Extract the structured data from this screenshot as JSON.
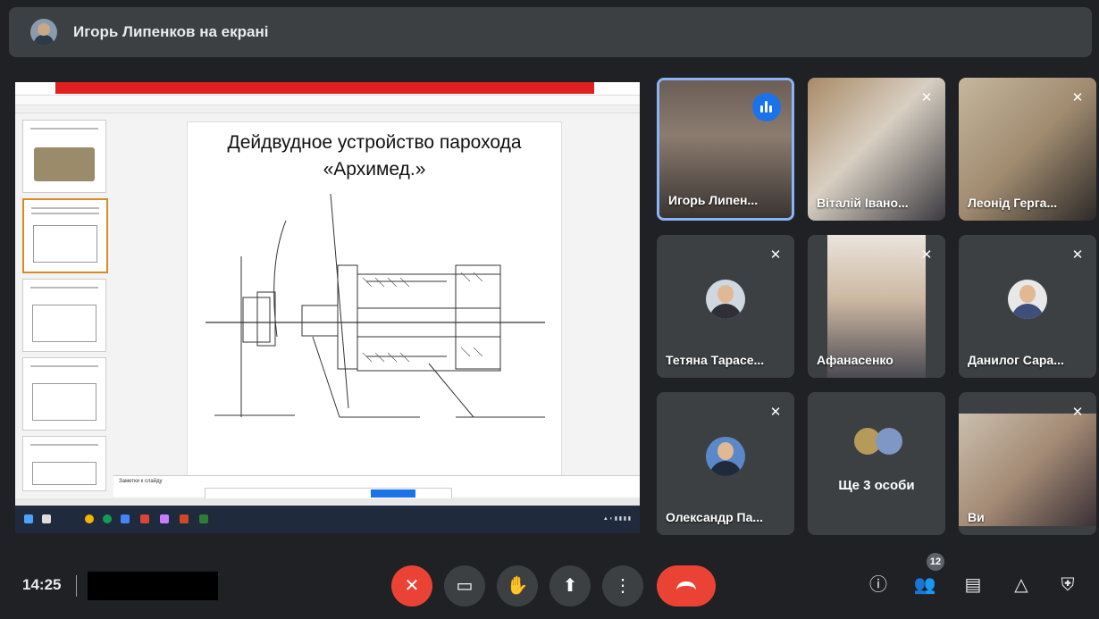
{
  "header": {
    "presenter_title": "Игорь Липенков на екрані"
  },
  "slide": {
    "title_line1": "Дейдвудное устройство парохода",
    "title_line2": "«Архимед.»",
    "notes_label": "Заметки к слайду"
  },
  "participants": [
    {
      "name": "Игорь Липен...",
      "state": "speaking"
    },
    {
      "name": "Віталій Івано...",
      "state": "muted"
    },
    {
      "name": "Леонід Герга...",
      "state": "muted"
    },
    {
      "name": "Тетяна Тарасе...",
      "state": "muted"
    },
    {
      "name": "Афанасенко",
      "state": "muted"
    },
    {
      "name": "Данилог Сара...",
      "state": "muted"
    },
    {
      "name": "Олександр Па...",
      "state": "muted"
    },
    {
      "name": "Ще 3 особи",
      "state": "group"
    },
    {
      "name": "Ви",
      "state": "muted"
    }
  ],
  "bottom_bar": {
    "clock": "14:25",
    "participant_count": "12"
  },
  "icons": {
    "mic_off": "✕",
    "camera": "▭",
    "raise_hand": "✋",
    "present": "⬆",
    "more": "⋮",
    "info": "ⓘ",
    "people": "👥",
    "chat": "▤",
    "activities": "△",
    "host": "⛨"
  },
  "colors": {
    "background": "#202124",
    "tile": "#3c4043",
    "active_border": "#8ab4f8",
    "danger": "#ea4335",
    "speaking": "#1a73e8"
  }
}
